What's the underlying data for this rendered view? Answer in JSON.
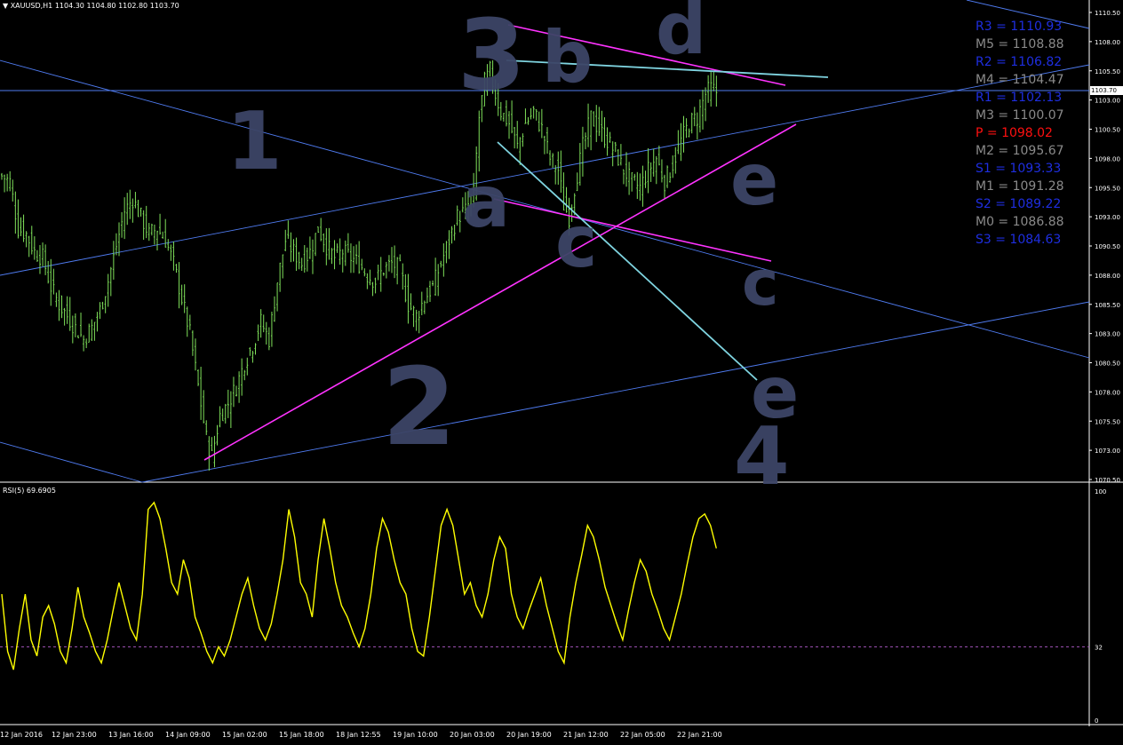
{
  "header": {
    "symbol": "XAUUSD,H1",
    "ohlc": "1104.30 1104.80 1102.80 1103.70"
  },
  "rsi_header": "RSI(5) 69.6905",
  "current_price": "1103.70",
  "colors": {
    "background": "#000000",
    "candle": "#7fe05a",
    "trendline": "#4f7bf0",
    "pink_line": "#ff33ff",
    "cyan_line": "#7fd4e0",
    "rsi_line": "#ffff00",
    "rsi_level": "#9a4fb0",
    "annotation": "#3c4466",
    "pivot_blue": "#1e2ee0",
    "pivot_gray": "#8a8a8a",
    "pivot_red": "#ff1010"
  },
  "pivots": [
    {
      "label": "R3 = 1110.93",
      "color": "#1e2ee0"
    },
    {
      "label": "M5 = 1108.88",
      "color": "#8a8a8a"
    },
    {
      "label": "R2 = 1106.82",
      "color": "#1e2ee0"
    },
    {
      "label": "M4 = 1104.47",
      "color": "#8a8a8a"
    },
    {
      "label": "R1 = 1102.13",
      "color": "#1e2ee0"
    },
    {
      "label": "M3 = 1100.07",
      "color": "#8a8a8a"
    },
    {
      "label": "P  = 1098.02",
      "color": "#ff1010"
    },
    {
      "label": "M2 = 1095.67",
      "color": "#8a8a8a"
    },
    {
      "label": "S1 = 1093.33",
      "color": "#1e2ee0"
    },
    {
      "label": "M1 = 1091.28",
      "color": "#8a8a8a"
    },
    {
      "label": "S2 = 1089.22",
      "color": "#1e2ee0"
    },
    {
      "label": "M0 = 1086.88",
      "color": "#8a8a8a"
    },
    {
      "label": "S3 = 1084.63",
      "color": "#1e2ee0"
    }
  ],
  "x_labels": [
    "12 Jan 2016",
    "12 Jan 23:00",
    "13 Jan 16:00",
    "14 Jan 09:00",
    "15 Jan 02:00",
    "15 Jan 18:00",
    "18 Jan 12:55",
    "19 Jan 10:00",
    "20 Jan 03:00",
    "20 Jan 19:00",
    "21 Jan 12:00",
    "22 Jan 05:00",
    "22 Jan 21:00"
  ],
  "annotations": [
    "1",
    "2",
    "3",
    "4",
    "a",
    "b",
    "c",
    "d",
    "e",
    "a",
    "b",
    "c",
    "d",
    "e"
  ],
  "chart_data": {
    "type": "candlestick",
    "price_axis": {
      "ticks": [
        "1110.50",
        "1108.00",
        "1105.50",
        "1103.00",
        "1100.50",
        "1098.00",
        "1095.50",
        "1093.00",
        "1090.50",
        "1088.00",
        "1085.50",
        "1083.00",
        "1080.50",
        "1078.00",
        "1075.50",
        "1073.00",
        "1070.50"
      ],
      "ylim": [
        1070.5,
        1110.5
      ]
    },
    "close_path": [
      [
        0,
        1096.5
      ],
      [
        3,
        1096.0
      ],
      [
        6,
        1092.0
      ],
      [
        9,
        1091.5
      ],
      [
        12,
        1090.0
      ],
      [
        15,
        1089.5
      ],
      [
        18,
        1087.0
      ],
      [
        21,
        1085.5
      ],
      [
        24,
        1084.5
      ],
      [
        27,
        1083.5
      ],
      [
        30,
        1082.5
      ],
      [
        33,
        1083.5
      ],
      [
        36,
        1085.0
      ],
      [
        39,
        1087.5
      ],
      [
        42,
        1090.5
      ],
      [
        45,
        1093.5
      ],
      [
        48,
        1094.5
      ],
      [
        51,
        1093.0
      ],
      [
        54,
        1091.5
      ],
      [
        57,
        1092.0
      ],
      [
        60,
        1091.0
      ],
      [
        63,
        1089.0
      ],
      [
        66,
        1086.0
      ],
      [
        69,
        1083.0
      ],
      [
        72,
        1078.5
      ],
      [
        75,
        1074.0
      ],
      [
        77,
        1072.5
      ],
      [
        80,
        1076.0
      ],
      [
        83,
        1077.0
      ],
      [
        86,
        1078.5
      ],
      [
        89,
        1080.5
      ],
      [
        92,
        1082.0
      ],
      [
        95,
        1084.0
      ],
      [
        98,
        1082.5
      ],
      [
        101,
        1087.5
      ],
      [
        104,
        1091.0
      ],
      [
        107,
        1090.0
      ],
      [
        110,
        1089.0
      ],
      [
        113,
        1090.0
      ],
      [
        116,
        1092.0
      ],
      [
        119,
        1090.5
      ],
      [
        122,
        1089.5
      ],
      [
        125,
        1090.0
      ],
      [
        128,
        1089.5
      ],
      [
        131,
        1089.0
      ],
      [
        134,
        1088.0
      ],
      [
        137,
        1087.5
      ],
      [
        140,
        1088.5
      ],
      [
        143,
        1089.0
      ],
      [
        146,
        1088.5
      ],
      [
        149,
        1085.5
      ],
      [
        152,
        1084.5
      ],
      [
        155,
        1086.0
      ],
      [
        158,
        1087.0
      ],
      [
        161,
        1089.0
      ],
      [
        164,
        1091.0
      ],
      [
        167,
        1093.0
      ],
      [
        170,
        1093.5
      ],
      [
        173,
        1095.0
      ],
      [
        175,
        1101.5
      ],
      [
        177,
        1104.5
      ],
      [
        179,
        1105.5
      ],
      [
        181,
        1103.5
      ],
      [
        183,
        1102.0
      ],
      [
        186,
        1101.0
      ],
      [
        189,
        1099.0
      ],
      [
        192,
        1101.0
      ],
      [
        195,
        1102.0
      ],
      [
        198,
        1100.5
      ],
      [
        201,
        1098.0
      ],
      [
        204,
        1097.0
      ],
      [
        206,
        1094.0
      ],
      [
        208,
        1093.0
      ],
      [
        210,
        1095.5
      ],
      [
        213,
        1099.0
      ],
      [
        216,
        1101.5
      ],
      [
        219,
        1100.5
      ],
      [
        222,
        1099.5
      ],
      [
        225,
        1098.5
      ],
      [
        228,
        1097.0
      ],
      [
        231,
        1096.0
      ],
      [
        234,
        1095.5
      ],
      [
        237,
        1097.0
      ],
      [
        240,
        1098.0
      ],
      [
        243,
        1096.0
      ],
      [
        246,
        1097.5
      ],
      [
        249,
        1099.5
      ],
      [
        252,
        1101.0
      ],
      [
        255,
        1101.5
      ],
      [
        258,
        1103.5
      ],
      [
        260,
        1104.0
      ],
      [
        262,
        1103.7
      ]
    ],
    "rsi": {
      "level": 32,
      "axis_ticks": [
        "100",
        "32",
        "0"
      ],
      "values": [
        55,
        30,
        22,
        40,
        55,
        35,
        28,
        45,
        50,
        42,
        30,
        25,
        40,
        58,
        45,
        38,
        30,
        25,
        35,
        48,
        60,
        50,
        40,
        35,
        55,
        92,
        95,
        88,
        75,
        60,
        55,
        70,
        62,
        45,
        38,
        30,
        25,
        32,
        28,
        35,
        45,
        55,
        62,
        50,
        40,
        35,
        42,
        55,
        70,
        92,
        80,
        60,
        55,
        45,
        70,
        88,
        75,
        60,
        50,
        45,
        38,
        32,
        40,
        55,
        75,
        88,
        82,
        70,
        60,
        55,
        40,
        30,
        28,
        45,
        65,
        85,
        92,
        85,
        70,
        55,
        60,
        50,
        45,
        55,
        70,
        80,
        75,
        55,
        45,
        40,
        48,
        55,
        62,
        50,
        40,
        30,
        25,
        45,
        60,
        72,
        85,
        80,
        70,
        58,
        50,
        42,
        35,
        48,
        60,
        70,
        65,
        55,
        48,
        40,
        35,
        45,
        55,
        68,
        80,
        88,
        90,
        85,
        75
      ],
      "ylim": [
        0,
        100
      ]
    },
    "wave_counts": [
      "1",
      "2",
      "3",
      "4",
      "a",
      "b",
      "c",
      "d",
      "e"
    ]
  }
}
